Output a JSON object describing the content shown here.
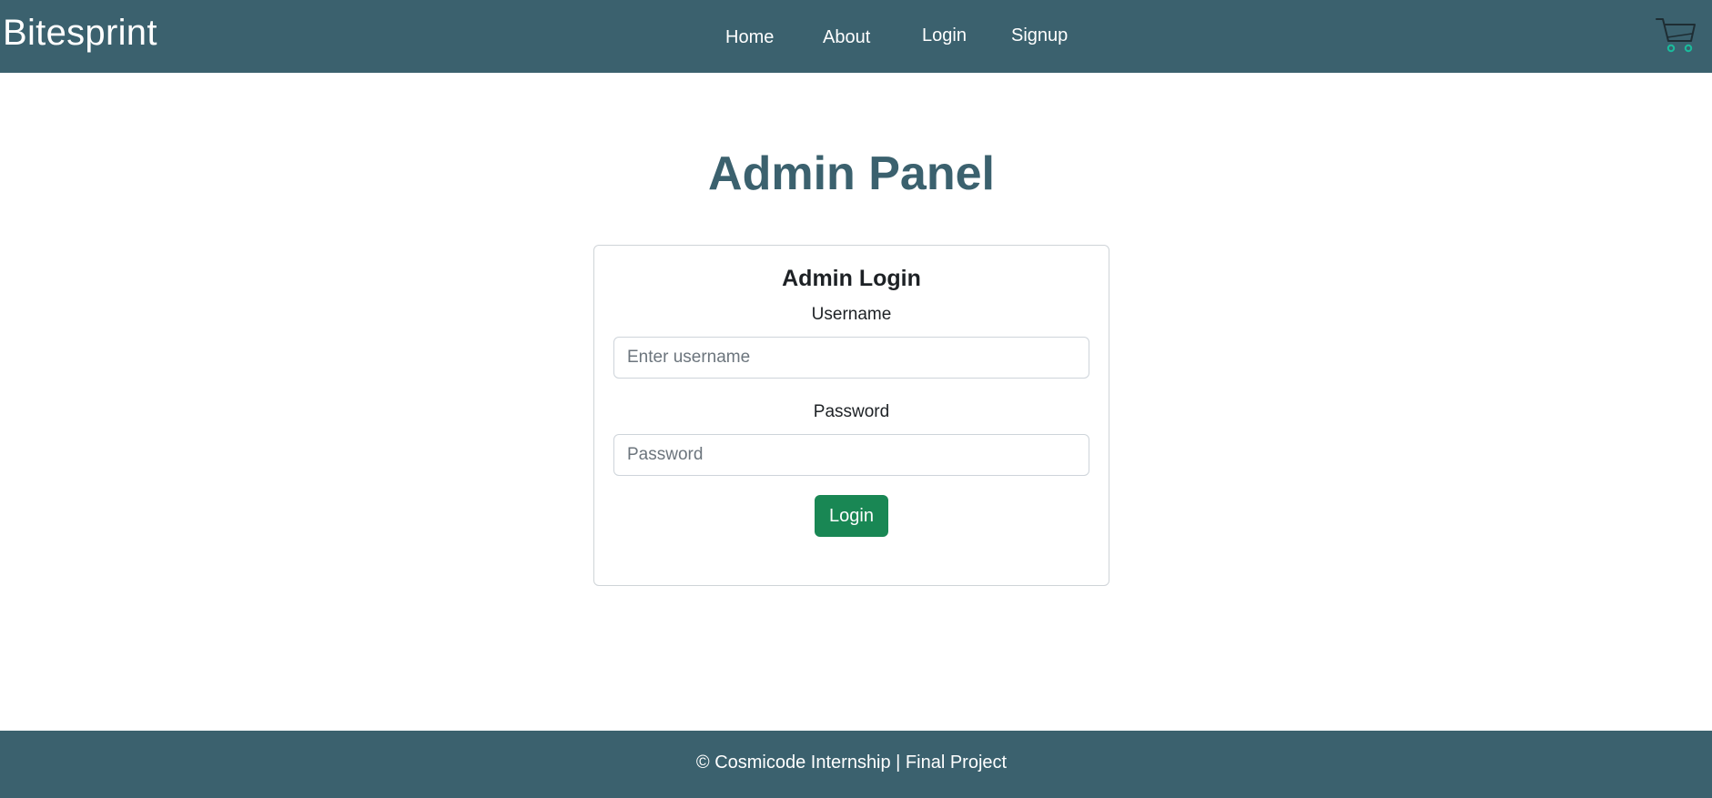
{
  "navbar": {
    "brand": "Bitesprint",
    "links": [
      "Home",
      "About",
      "Login",
      "Signup"
    ],
    "cart_icon": "cart-icon"
  },
  "page": {
    "title": "Admin Panel"
  },
  "login_card": {
    "title": "Admin Login",
    "username_label": "Username",
    "username_placeholder": "Enter username",
    "username_value": "",
    "password_label": "Password",
    "password_placeholder": "Password",
    "password_value": "",
    "submit_label": "Login"
  },
  "footer": {
    "text": "© Cosmicode Internship | Final Project"
  },
  "colors": {
    "primary": "#3b616e",
    "button": "#198754",
    "cart_wheels": "#1abc9c"
  }
}
